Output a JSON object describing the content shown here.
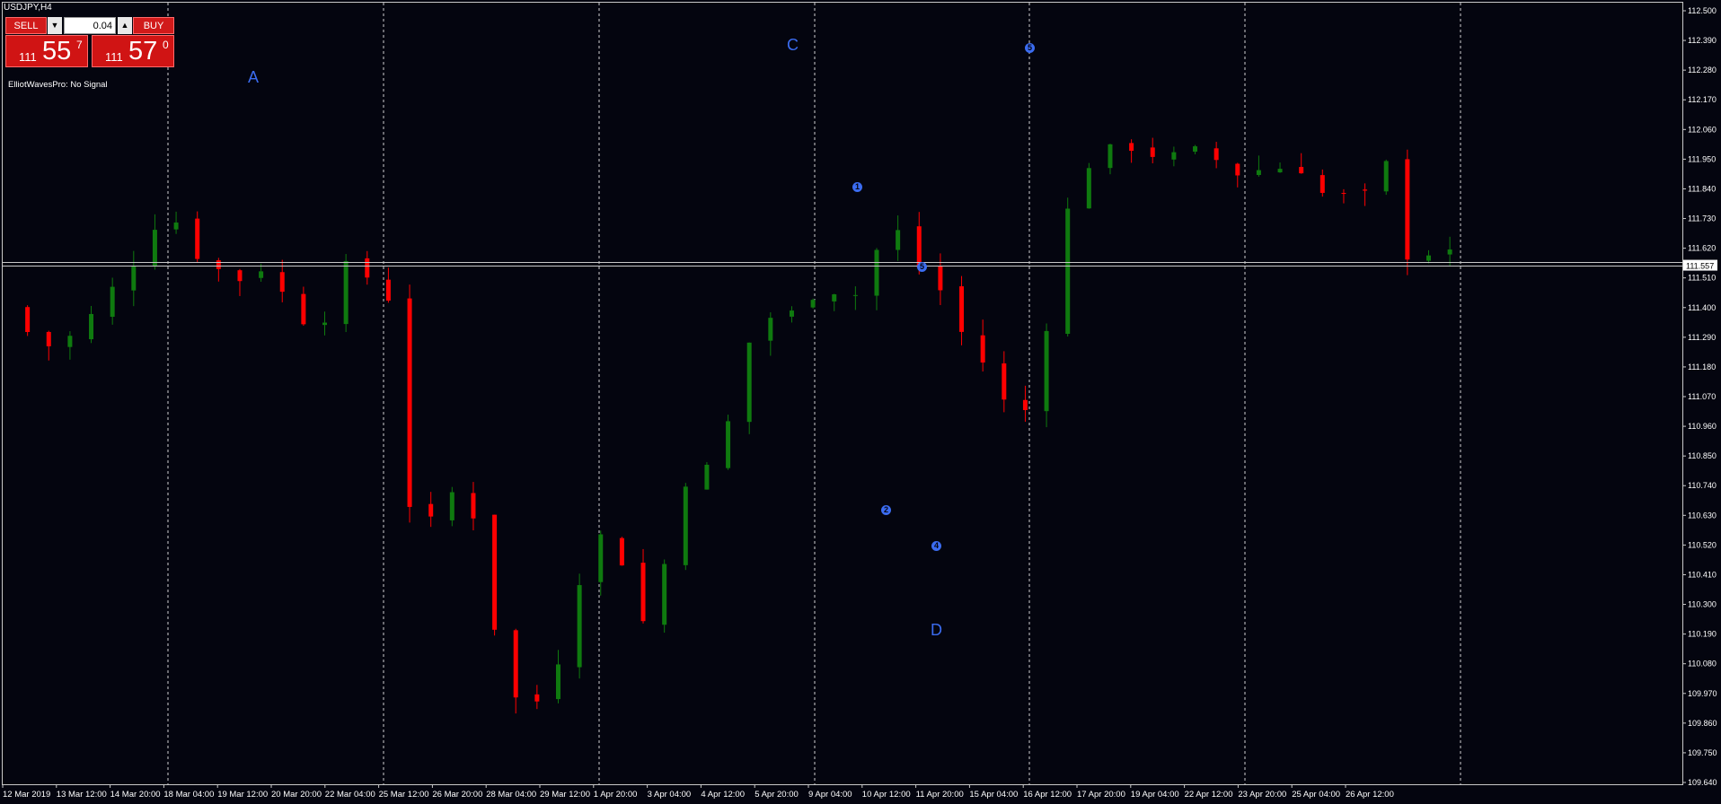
{
  "window": {
    "title": "USDJPY,H4"
  },
  "trade_panel": {
    "sell_label": "SELL",
    "buy_label": "BUY",
    "lot_value": "0.04",
    "sell_price": {
      "small": "111",
      "big": "55",
      "sup": "7"
    },
    "buy_price": {
      "small": "111",
      "big": "57",
      "sup": "0"
    }
  },
  "indicator_status": "ElliotWavesPro: No Signal",
  "wave_labels": {
    "A": "A",
    "C": "C",
    "D": "D",
    "one": "1",
    "two": "2",
    "four": "4",
    "five_top": "5",
    "five_mid": "5"
  },
  "colors": {
    "background": "#04050f",
    "bull": "#0f7a0f",
    "bear": "#ff0000",
    "grid": "#c8c8c8",
    "wave": "#3b6cf0"
  },
  "chart_data": {
    "type": "candlestick",
    "symbol": "USDJPY",
    "timeframe": "H4",
    "y_ticks": [
      "112.500",
      "112.390",
      "112.280",
      "112.170",
      "112.060",
      "111.950",
      "111.840",
      "111.730",
      "111.620",
      "111.510",
      "111.400",
      "111.290",
      "111.180",
      "111.070",
      "110.960",
      "110.850",
      "110.740",
      "110.630",
      "110.520",
      "110.410",
      "110.300",
      "110.190",
      "110.080",
      "109.970",
      "109.860",
      "109.750",
      "109.640"
    ],
    "ylim": [
      109.64,
      112.5
    ],
    "current_price": "111.557",
    "x_ticks": [
      "12 Mar 2019",
      "13 Mar 12:00",
      "14 Mar 20:00",
      "18 Mar 04:00",
      "19 Mar 12:00",
      "20 Mar 20:00",
      "22 Mar 04:00",
      "25 Mar 12:00",
      "26 Mar 20:00",
      "28 Mar 04:00",
      "29 Mar 12:00",
      "1 Apr 20:00",
      "3 Apr 04:00",
      "4 Apr 12:00",
      "5 Apr 20:00",
      "9 Apr 04:00",
      "10 Apr 12:00",
      "11 Apr 20:00",
      "15 Apr 04:00",
      "16 Apr 12:00",
      "17 Apr 20:00",
      "19 Apr 04:00",
      "22 Apr 12:00",
      "23 Apr 20:00",
      "25 Apr 04:00",
      "26 Apr 12:00"
    ]
  }
}
